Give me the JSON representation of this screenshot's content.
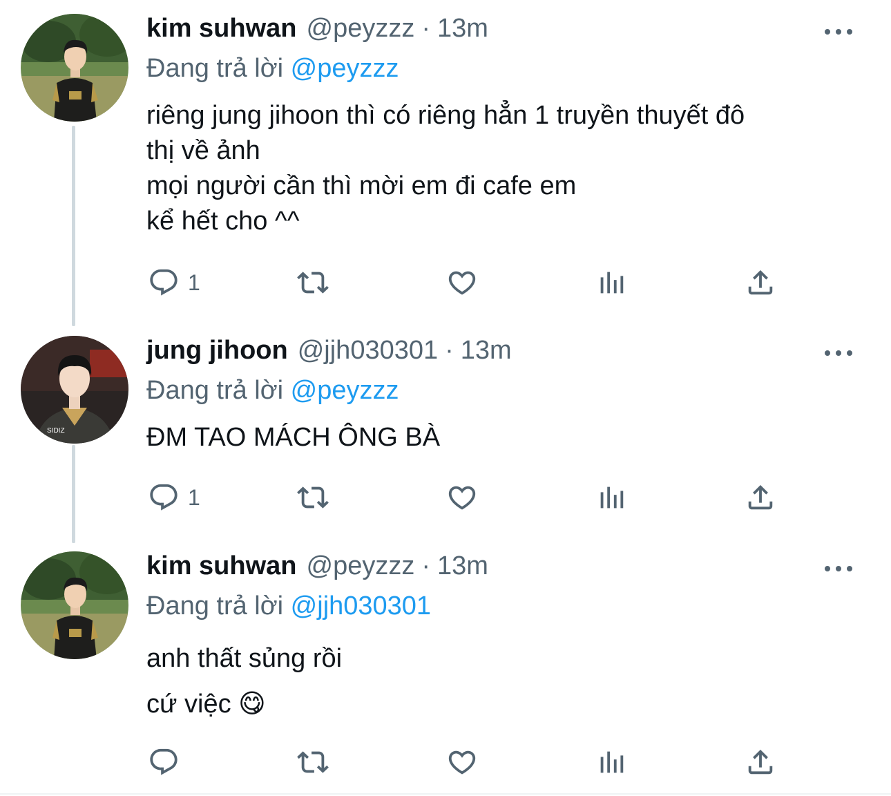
{
  "tweets": [
    {
      "name": "kim suhwan",
      "handle": "@peyzzz",
      "separator": "·",
      "time": "13m",
      "reply_prefix": "Đang trả lời",
      "reply_to": "@peyzzz",
      "lines": [
        "riêng jung jihoon thì có riêng hẳn 1 truyền thuyết đô",
        "thị về ảnh",
        "mọi người cần thì mời em đi cafe em",
        "kể hết cho ^^"
      ],
      "reply_count": "1"
    },
    {
      "name": "jung jihoon",
      "handle": "@jjh030301",
      "separator": "·",
      "time": "13m",
      "reply_prefix": "Đang trả lời",
      "reply_to": "@peyzzz",
      "lines": [
        "ĐM TAO MÁCH ÔNG BÀ"
      ],
      "reply_count": "1",
      "avatar_text": "SIDIZ"
    },
    {
      "name": "kim suhwan",
      "handle": "@peyzzz",
      "separator": "·",
      "time": "13m",
      "reply_prefix": "Đang trả lời",
      "reply_to": "@jjh030301",
      "lines": [
        "anh thất sủng rồi",
        "cứ việc 😋"
      ],
      "reply_count": ""
    }
  ],
  "icons": {
    "reply": "reply-icon",
    "retweet": "retweet-icon",
    "like": "heart-icon",
    "analytics": "analytics-icon",
    "share": "share-icon",
    "more": "more-icon"
  },
  "colors": {
    "text": "#0f1419",
    "secondary": "#536471",
    "link": "#1d9bf0",
    "thread_line": "#cfd9de"
  }
}
